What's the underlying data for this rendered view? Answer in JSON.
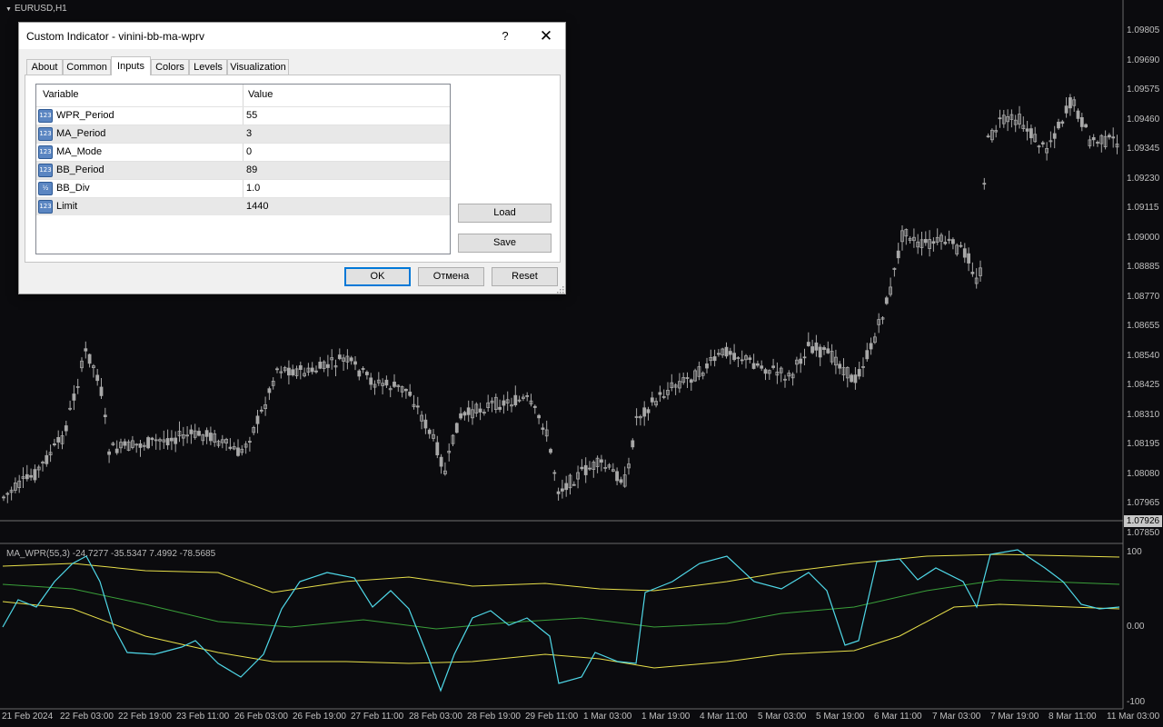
{
  "chart": {
    "symbol": "EURUSD,H1",
    "indicator_label": "MA_WPR(55,3) -24.7277 -35.5347 7.4992 -78.5685",
    "current_price": "1.07926",
    "price_ticks": [
      "1.09805",
      "1.09690",
      "1.09575",
      "1.09460",
      "1.09345",
      "1.09230",
      "1.09115",
      "1.09000",
      "1.08885",
      "1.08770",
      "1.08655",
      "1.08540",
      "1.08425",
      "1.08310",
      "1.08195",
      "1.08080",
      "1.07965",
      "1.07850"
    ],
    "indicator_ticks": [
      "100",
      "0.00",
      "-100"
    ],
    "time_ticks": [
      "21 Feb 2024",
      "22 Feb 03:00",
      "22 Feb 19:00",
      "23 Feb 11:00",
      "26 Feb 03:00",
      "26 Feb 19:00",
      "27 Feb 11:00",
      "28 Feb 03:00",
      "28 Feb 19:00",
      "29 Feb 11:00",
      "1 Mar 03:00",
      "1 Mar 19:00",
      "4 Mar 11:00",
      "5 Mar 03:00",
      "5 Mar 19:00",
      "6 Mar 11:00",
      "7 Mar 03:00",
      "7 Mar 19:00",
      "8 Mar 11:00",
      "11 Mar 03:00"
    ],
    "colors": {
      "background": "#0b0b0e",
      "candle": "#a8a8a8",
      "wpr": "#4fd8e8",
      "band": "#e8e04a",
      "mid": "#3aa03a"
    }
  },
  "dialog": {
    "title": "Custom Indicator - vinini-bb-ma-wprv",
    "help": "?",
    "close": "✕",
    "tabs": [
      "About",
      "Common",
      "Inputs",
      "Colors",
      "Levels",
      "Visualization"
    ],
    "active_tab": "Inputs",
    "table": {
      "col_variable": "Variable",
      "col_value": "Value",
      "rows": [
        {
          "icon": "int-icon",
          "badge": "123",
          "name": "WPR_Period",
          "value": "55"
        },
        {
          "icon": "int-icon",
          "badge": "123",
          "name": "MA_Period",
          "value": "3"
        },
        {
          "icon": "int-icon",
          "badge": "123",
          "name": "MA_Mode",
          "value": "0"
        },
        {
          "icon": "int-icon",
          "badge": "123",
          "name": "BB_Period",
          "value": "89"
        },
        {
          "icon": "double-icon",
          "badge": "½",
          "name": "BB_Div",
          "value": "1.0"
        },
        {
          "icon": "int-icon",
          "badge": "123",
          "name": "Limit",
          "value": "1440"
        }
      ]
    },
    "load_label": "Load",
    "save_label": "Save",
    "ok_label": "OK",
    "cancel_label": "Отмена",
    "reset_label": "Reset"
  }
}
